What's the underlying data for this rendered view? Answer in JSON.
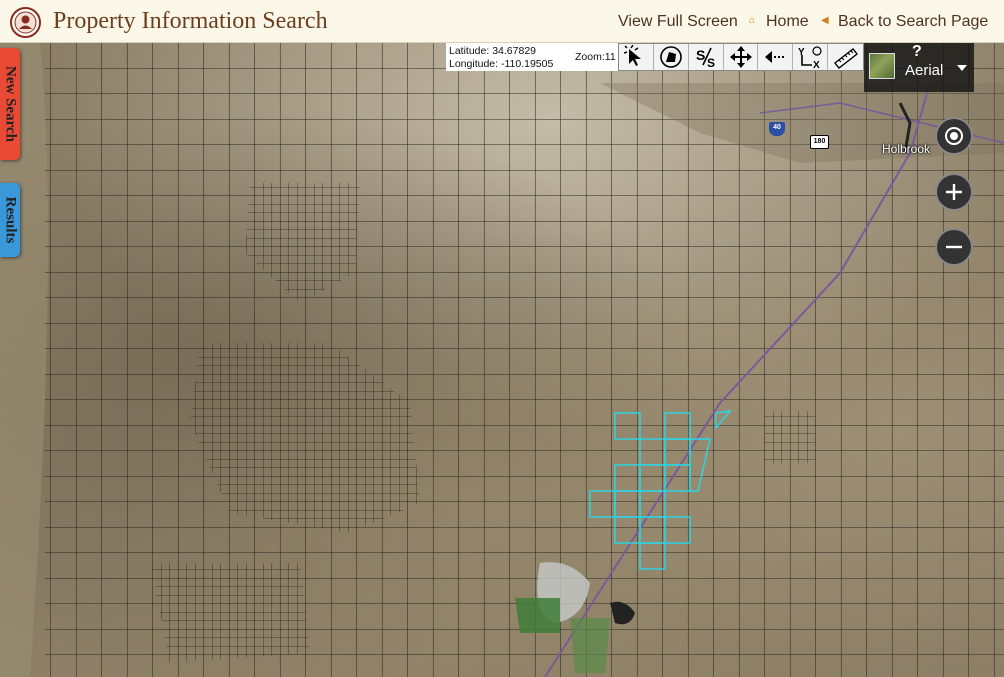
{
  "header": {
    "title": "Property Information Search",
    "view_full_screen": "View Full Screen",
    "home": "Home",
    "back": "Back to Search Page"
  },
  "side_tabs": {
    "new_search": "New Search",
    "results": "Results"
  },
  "coords": {
    "latitude": "Latitude: 34.67829",
    "longitude": "Longitude: -110.19505"
  },
  "zoom": "Zoom:11",
  "toolbar": {
    "tools": [
      "identify-cursor-icon",
      "polygon-select-icon",
      "swipe-icon",
      "pan-icon",
      "back-extent-icon",
      "xy-coordinate-icon",
      "measure-ruler-icon"
    ]
  },
  "basemap": {
    "label": "Aerial",
    "help": "?"
  },
  "map": {
    "place_label": "Holbrook",
    "shield_interstate": "40",
    "shield_us": "180",
    "colors": {
      "parcel_line": "#2a2620",
      "selected_parcel": "#26d8e8",
      "railroad": "#7a5a9a"
    }
  }
}
